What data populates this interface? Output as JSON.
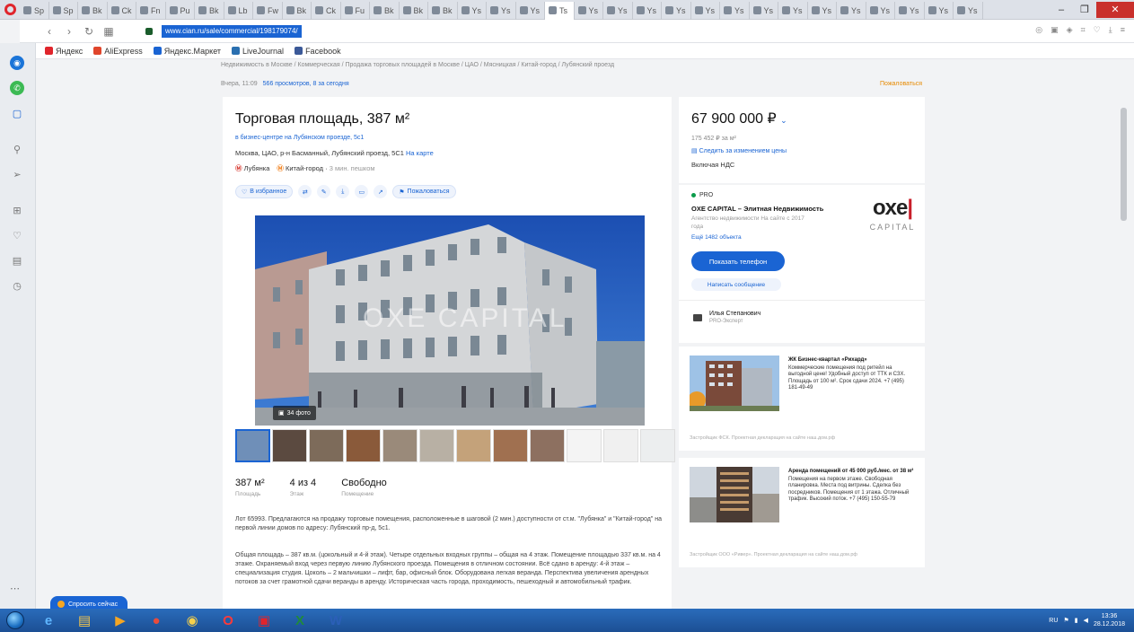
{
  "browser": {
    "tab_labels": [
      "Sp",
      "Sp",
      "Bk",
      "Ck",
      "Fn",
      "Pu",
      "Bk",
      "Lb",
      "Fw",
      "Bk",
      "Ck",
      "Fu",
      "Bk",
      "Bk",
      "Bk",
      "Ys",
      "Ys",
      "Ys",
      "Ts",
      "Ys",
      "Ys",
      "Ys",
      "Ys",
      "Ys",
      "Ys",
      "Ys",
      "Ys",
      "Ys",
      "Ys",
      "Ys",
      "Ys",
      "Ys",
      "Ys"
    ],
    "active_tab_label": "Ts",
    "url": "www.cian.ru/sale/commercial/198179074/",
    "bookmarks": [
      {
        "label": "Яндекс",
        "color": "#e0252c"
      },
      {
        "label": "AliExpress",
        "color": "#e0452c"
      },
      {
        "label": "Яндекс.Маркет",
        "color": "#1a64d3"
      },
      {
        "label": "LiveJournal",
        "color": "#2a6fb0"
      },
      {
        "label": "Facebook",
        "color": "#3b5998"
      }
    ]
  },
  "page": {
    "breadcrumb": "Недвижимость в Москве / Коммерческая / Продажа торговых площадей в Москве / ЦАО / Мясницкая / Китай-город / Лубянский проезд",
    "views": "Вчера, 11:09",
    "views_link": "566 просмотров, 8 за сегодня",
    "complain": "Пожаловаться",
    "title": "Торговая площадь, 387 м²",
    "building_link": "в бизнес-центре на Лубянском проезде, 5с1",
    "address": "Москва, ЦАО, р-н Басманный, Лубянский проезд, 5С1",
    "map_link": "На карте",
    "metro": [
      {
        "name": "Лубянка",
        "color": "#d6352c"
      },
      {
        "name": "Китай-город",
        "color": "#f07f1b"
      }
    ],
    "metro_time": "3 мин. пешком",
    "action_favorite": "В избранное",
    "action_complain": "Пожаловаться",
    "action_icons": [
      "compare-icon",
      "pen-icon",
      "download-icon",
      "print-icon",
      "share-icon"
    ],
    "photo_count": "34 фото",
    "watermark": "OXE CAPITAL",
    "thumb_count": 12,
    "stats": [
      {
        "value": "387 м²",
        "label": "Площадь"
      },
      {
        "value": "4 из 4",
        "label": "Этаж"
      },
      {
        "value": "Свободно",
        "label": "Помещение"
      }
    ],
    "desc1": "Лот 65993. Предлагаются на продажу торговые помещения, расположенные в шаговой (2 мин.) доступности от ст.м. \"Лубянка\" и \"Китай-город\" на первой линии домов по адресу: Лубянский пр-д, 5с1.",
    "desc2": "Общая площадь – 387 кв.м. (цокольный и 4-й этаж). Четыре отдельных входных группы – общая на 4 этаж. Помещение площадью 337 кв.м. на 4 этаже. Охраняемый вход через первую линию Лубянского проезда. Помещения в отличном состоянии. Всё сдано в аренду: 4-й этаж – специализация студия. Цоколь – 2 мальчишки – лифт, бар, офисный блок. Оборудована легкая веранда. Перспектива увеличения арендных потоков за счет грамотной сдачи веранды в аренду. Историческая часть города, проходимость, пешеходный и автомобильный трафик."
  },
  "sidebar_right": {
    "price": "67 900 000 ₽",
    "price_per": "175 452 ₽ за м²",
    "price_watch": "Следить за изменением цены",
    "price_vat": "Включая НДС",
    "agent_pro": "PRO",
    "agent_name": "OXE CAPITAL – Элитная Недвижимость",
    "agent_type": "Агентство недвижимости На сайте с 2017 года",
    "agent_more": "Ещё 1482 объекта",
    "logo_mark": "oxe",
    "logo_word": "CAPITAL",
    "show_phone": "Показать телефон",
    "write_msg": "Написать сообщение",
    "contact_name": "Илья Степанович",
    "contact_role": "PRO-Эксперт",
    "ads": [
      {
        "head": "ЖК Бизнес-квартал «Рихард»",
        "text": "Коммерческие помещения под ритейл на выгодной цене! Удобный доступ от ТТК и СЗХ. Площадь от 100 м². Срок сдачи 2024. +7 (495) 181-49-49",
        "foot": "Застройщик ФСК. Проектная декларация на сайте наш.дом.рф"
      },
      {
        "head": "Аренда помещений от 45 000 руб./мес. от 38 м²",
        "text": "Помещения на первом этаже. Свободная планировка. Места под витрины. Сделка без посредников. Помещения от 1 этажа. Отличный трафик. Высокий поток. +7 (495) 150-55-79",
        "foot": "Застройщик ООО «Ривер». Проектная декларация на сайте наш.дом.рф"
      }
    ]
  },
  "chat": {
    "label": "Спросить сейчас"
  },
  "taskbar": {
    "apps": [
      {
        "glyph": "e",
        "color": "#5fb6ff",
        "icon": "ie-icon"
      },
      {
        "glyph": "▤",
        "color": "#f5c64b",
        "icon": "folder-icon"
      },
      {
        "glyph": "▶",
        "color": "#f5a623",
        "icon": "media-player-icon"
      },
      {
        "glyph": "●",
        "color": "#e74c3c",
        "icon": "chrome-icon"
      },
      {
        "glyph": "◉",
        "color": "#f5d04b",
        "icon": "yandex-icon"
      },
      {
        "glyph": "O",
        "color": "#ff3a3a",
        "icon": "opera-icon"
      },
      {
        "glyph": "▣",
        "color": "#e0252c",
        "icon": "acrobat-icon"
      },
      {
        "glyph": "X",
        "color": "#1f8a3b",
        "icon": "excel-icon"
      },
      {
        "glyph": "W",
        "color": "#2b5fb8",
        "icon": "word-icon"
      }
    ],
    "tray_lang": "RU",
    "time": "13:36",
    "date": "28.12.2018"
  }
}
